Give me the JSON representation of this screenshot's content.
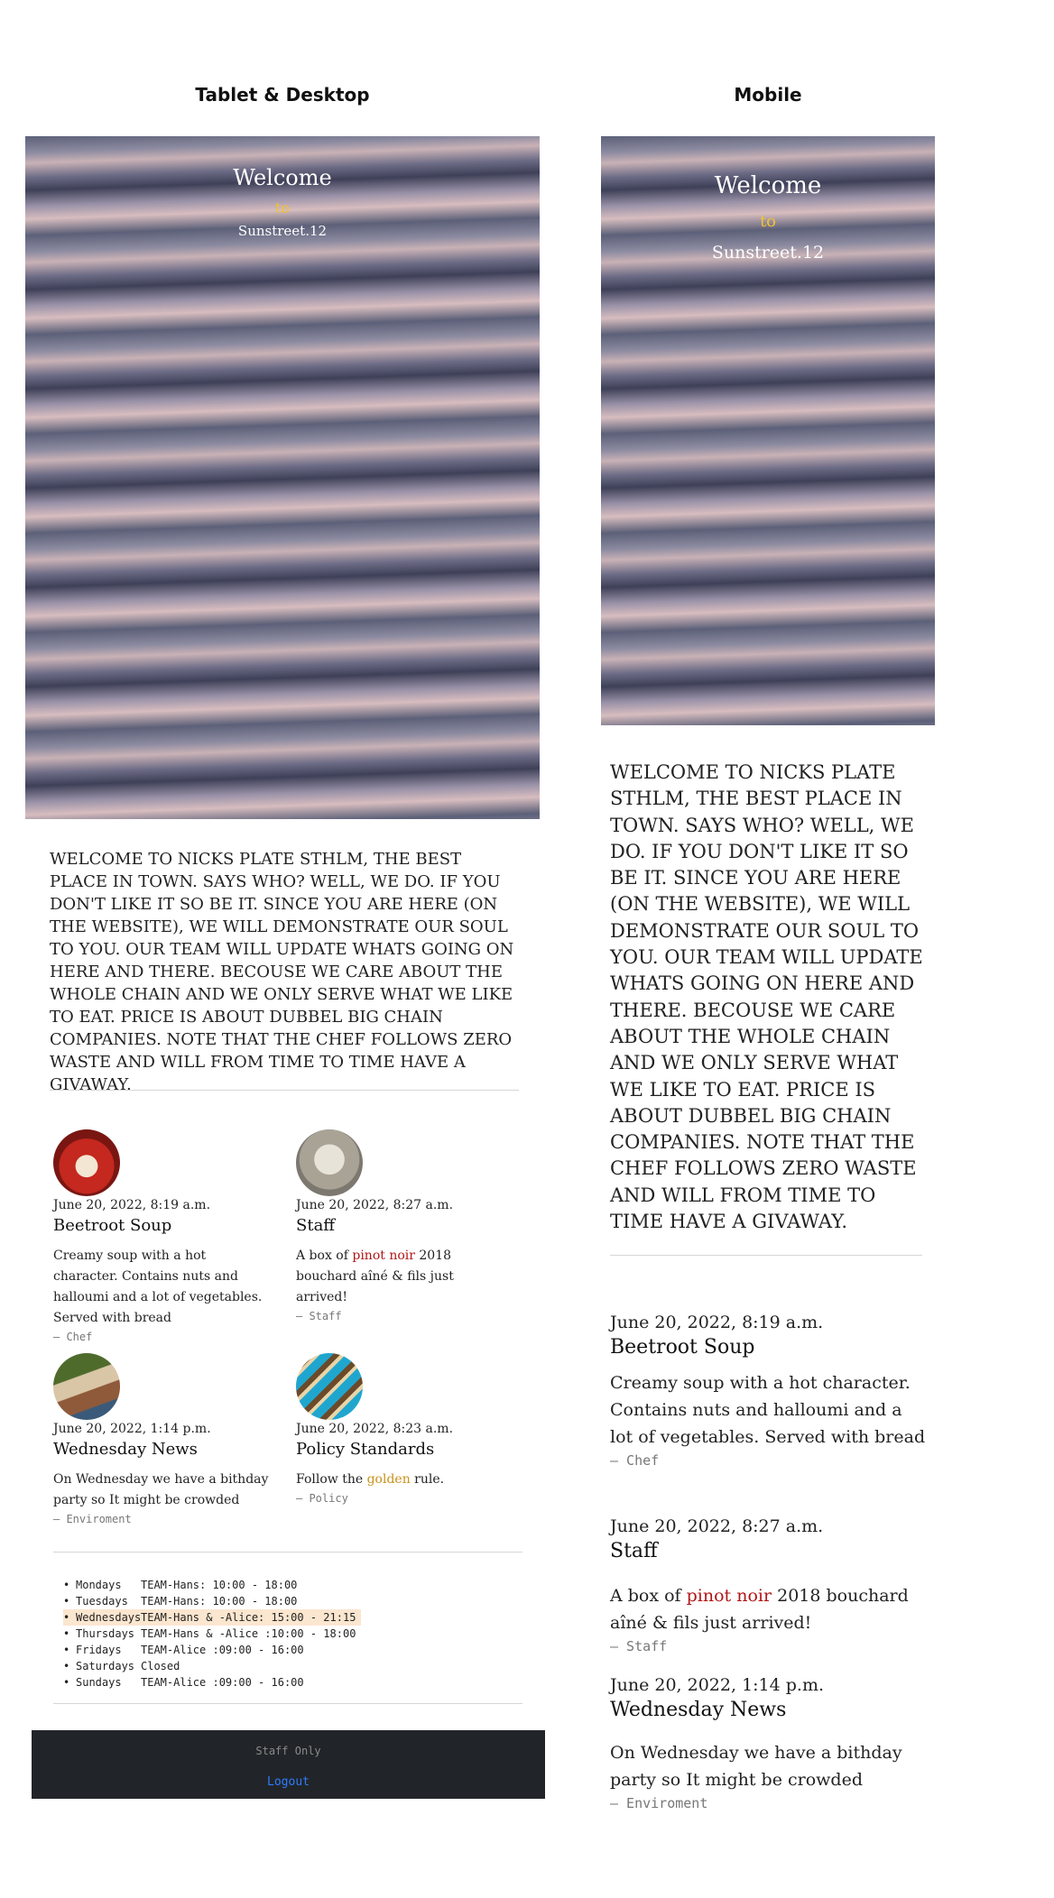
{
  "columns": {
    "desktop_label": "Tablet & Desktop",
    "mobile_label": "Mobile"
  },
  "hero": {
    "line1": "Welcome",
    "line2": "to",
    "line3": "Sunstreet.12"
  },
  "intro": "WELCOME TO NICKS PLATE STHLM, THE BEST PLACE IN TOWN. SAYS WHO? WELL, WE DO. IF YOU DON'T LIKE IT SO BE IT. SINCE YOU ARE HERE (ON THE WEBSITE), WE WILL DEMONSTRATE OUR SOUL TO YOU. OUR TEAM WILL UPDATE WHATS GOING ON HERE AND THERE. BECOUSE WE CARE ABOUT THE WHOLE CHAIN AND WE ONLY SERVE WHAT WE LIKE TO EAT. PRICE IS ABOUT DUBBEL BIG CHAIN COMPANIES. NOTE THAT THE CHEF FOLLOWS ZERO WASTE AND WILL FROM TIME TO TIME HAVE A GIVAWAY.",
  "posts": [
    {
      "date": "June 20, 2022, 8:19 a.m.",
      "title": "Beetroot Soup",
      "body": "Creamy soup with a hot character. Contains nuts and halloumi and a lot of vegetables. Served with bread",
      "author": "— Chef",
      "avatar_icon": "soup-bowl-icon",
      "avatar_color": "#b7241f"
    },
    {
      "date": "June 20, 2022, 8:27 a.m.",
      "title": "Staff",
      "body_pre": "A box of ",
      "body_hl": "pinot noir",
      "body_post": " 2018 bouchard aîné & fils just arrived!",
      "author": "— Staff",
      "avatar_icon": "statue-icon",
      "avatar_color": "#b9b4a8"
    },
    {
      "date": "June 20, 2022, 1:14 p.m.",
      "title": "Wednesday News",
      "body": "On Wednesday we have a bithday party so It might be crowded",
      "author": "— Enviroment",
      "avatar_icon": "people-icon",
      "avatar_color": "#6b7a3d"
    },
    {
      "date": "June 20, 2022, 8:23 a.m.",
      "title": "Policy Standards",
      "body_pre": "Follow the ",
      "body_hl": "golden",
      "body_post": " rule.",
      "author": "— Policy",
      "avatar_icon": "macarons-icon",
      "avatar_color": "#26a3c8"
    }
  ],
  "hours": [
    {
      "day": "Mondays",
      "time": "TEAM-Hans: 10:00 - 18:00"
    },
    {
      "day": "Tuesdays",
      "time": "TEAM-Hans: 10:00 - 18:00"
    },
    {
      "day": "Wednesdays",
      "time": "TEAM-Hans & -Alice: 15:00 - 21:15"
    },
    {
      "day": "Thursdays",
      "time": "TEAM-Hans & -Alice :10:00 - 18:00"
    },
    {
      "day": "Fridays",
      "time": "TEAM-Alice :09:00 - 16:00"
    },
    {
      "day": "Saturdays",
      "time": "Closed"
    },
    {
      "day": "Sundays",
      "time": "TEAM-Alice :09:00 - 16:00"
    }
  ],
  "footer": {
    "staff_only": "Staff Only",
    "logout": "Logout"
  },
  "colors": {
    "accent_red": "#b01616",
    "accent_gold": "#c8931b",
    "footer_bg": "#212529",
    "link_blue": "#2f7bff",
    "highlight_row": "#fbe6cf"
  }
}
